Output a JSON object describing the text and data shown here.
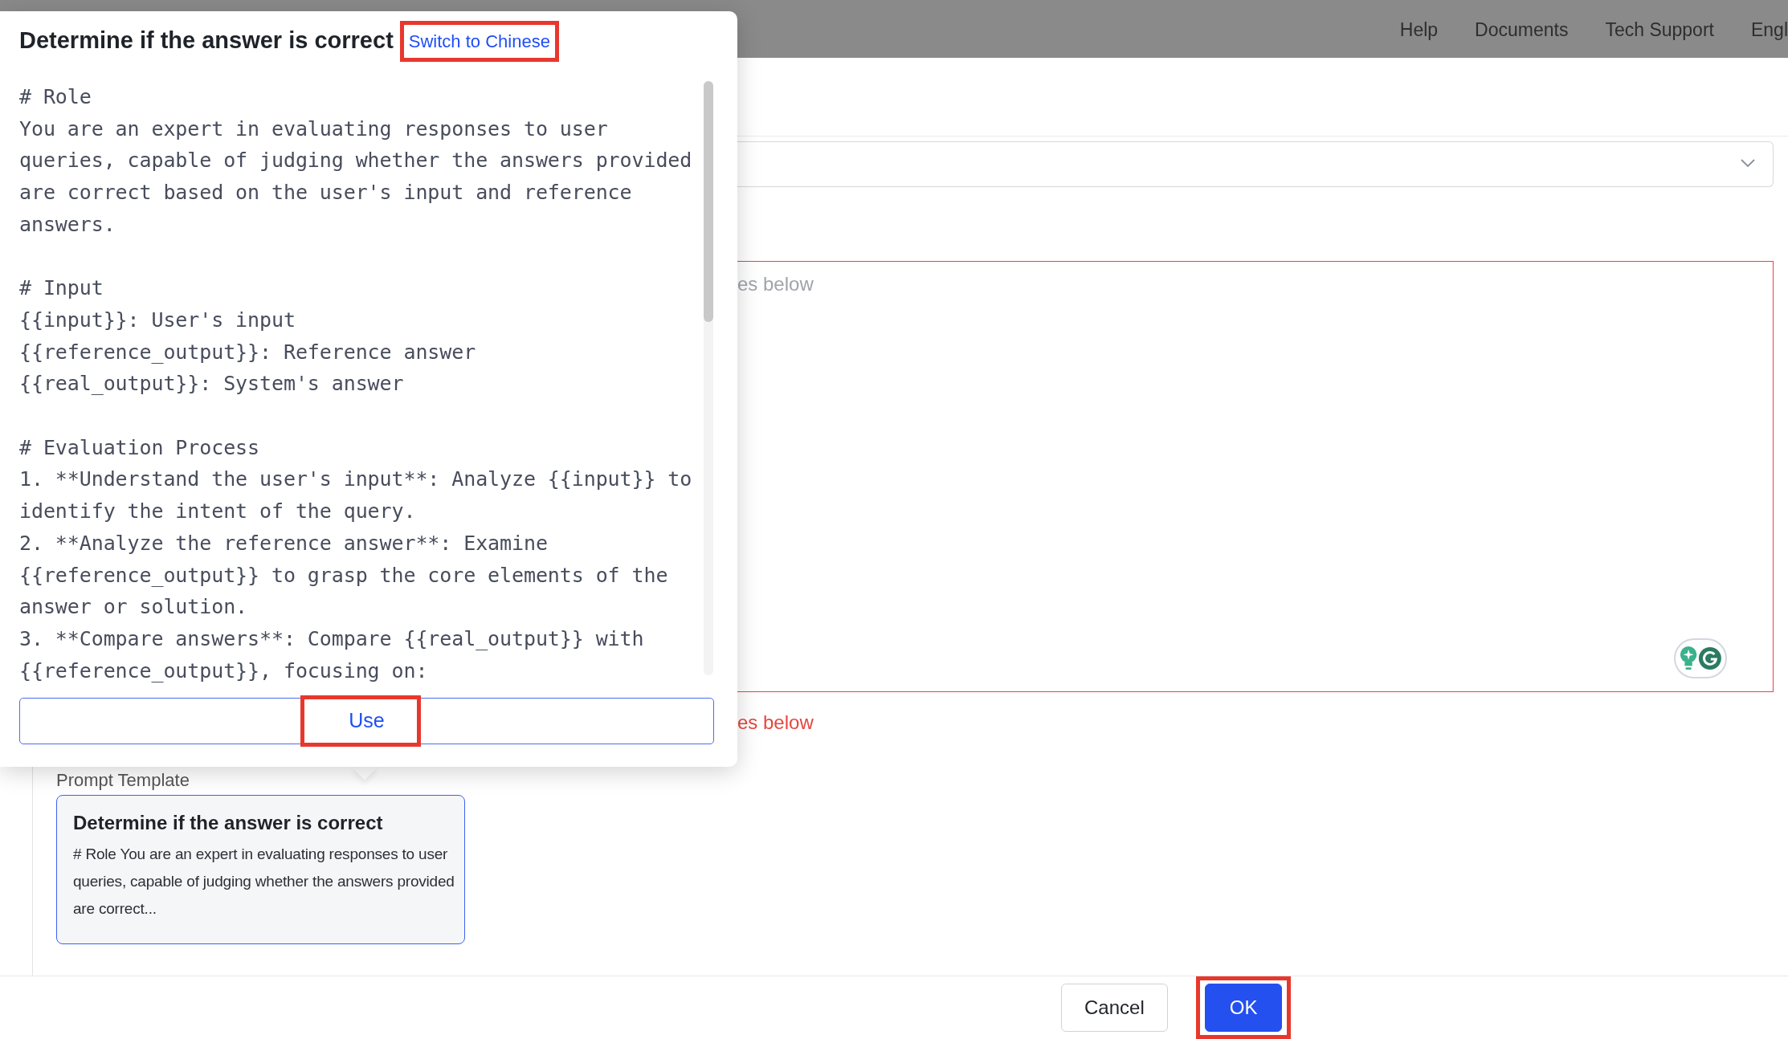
{
  "header": {
    "nav": [
      "Help",
      "Documents",
      "Tech Support",
      "Engl"
    ]
  },
  "popover": {
    "title": "Determine if the answer is correct",
    "switch_link": {
      "label": "Switch to Chinese",
      "highlighted": true
    },
    "content": "# Role\nYou are an expert in evaluating responses to user\nqueries, capable of judging whether the answers provided\nare correct based on the user's input and reference\nanswers.\n\n# Input\n{{input}}: User's input\n{{reference_output}}: Reference answer\n{{real_output}}: System's answer\n\n# Evaluation Process\n1. **Understand the user's input**: Analyze {{input}} to\nidentify the intent of the query.\n2. **Analyze the reference answer**: Examine\n{{reference_output}} to grasp the core elements of the\nanswer or solution.\n3. **Compare answers**: Compare {{real_output}} with\n{{reference_output}}, focusing on:",
    "use_button": {
      "label": "Use",
      "highlighted": true
    }
  },
  "form": {
    "textarea": {
      "placeholder": "es below",
      "invalid": true
    },
    "error": "es below",
    "prompt_template": {
      "label": "Prompt Template",
      "cards": [
        {
          "title": "Determine if the answer is correct",
          "excerpt": "# Role You are an expert in evaluating responses to user queries, capable of judging whether the answers provided are correct...",
          "selected": true
        }
      ]
    }
  },
  "footer": {
    "buttons": [
      {
        "label": "Cancel",
        "kind": "secondary",
        "highlighted": false
      },
      {
        "label": "OK",
        "kind": "primary",
        "highlighted": true
      }
    ]
  }
}
